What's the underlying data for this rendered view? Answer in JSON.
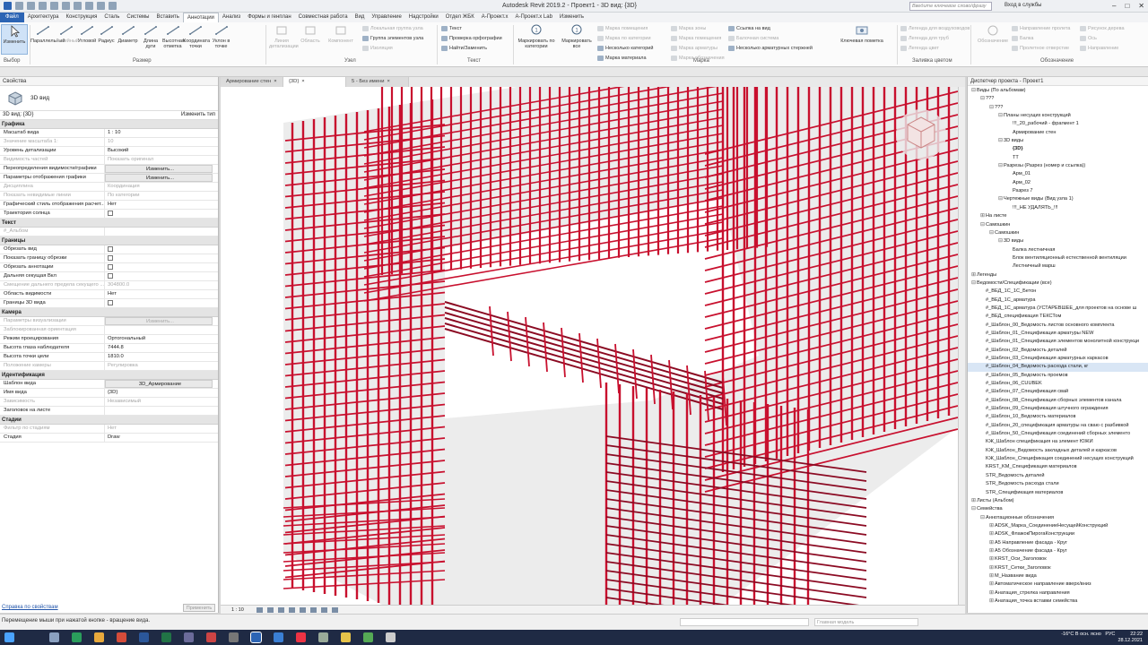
{
  "app": {
    "title": "Autodesk Revit 2019.2 - Проект1 - 3D вид: {3D}",
    "search_placeholder": "Введите ключевое слово/фразу",
    "login": "Вход в службы"
  },
  "tabs": [
    "Файл",
    "Архитектура",
    "Конструкция",
    "Сталь",
    "Системы",
    "Вставить",
    "Аннотации",
    "Анализ",
    "Формы и генплан",
    "Совместная работа",
    "Вид",
    "Управление",
    "Надстройки",
    "Отдел ЖБК",
    "А-Проект.х",
    "А-Проект.х Lab",
    "Изменить"
  ],
  "ribbon": {
    "modify": "Изменить",
    "select": "Выбор",
    "dims": [
      "Параллельный",
      "Линейный",
      "Угловой",
      "Радиус",
      "Диаметр",
      "Длина дуги",
      "Высотная отметка",
      "Координата точки",
      "Уклон в точке"
    ],
    "dim_panel": "Размер",
    "detail": [
      "Линия детализации",
      "Область",
      "Компонент"
    ],
    "detail_small": [
      "Локальная группа узла",
      "Группа элементов узла",
      "Изоляция"
    ],
    "detail_panel": "Узел",
    "text_small": [
      "Текст",
      "Проверка орфографии",
      "Найти/Заменить"
    ],
    "text_panel": "Текст",
    "tag_big": [
      "Маркировать по категории",
      "Маркировать все"
    ],
    "tag_small": [
      "Марка помещения",
      "Марка по категории",
      "Несколько категорий",
      "Марка материала",
      "Марка зоны",
      "Марка помещения",
      "Марка арматуры",
      "Марка обозначения",
      "Ссылка на вид",
      "Балочная система",
      "Несколько арматурных стержней"
    ],
    "tag_panel": "Марка",
    "fill_big": "Ключевая пометка",
    "fill_small": [
      "Легенда для воздуховодов",
      "Легенда для труб",
      "Легенда цвет"
    ],
    "fill_panel": "Заливка цветом",
    "sym_big": "Обозначение",
    "sym_small": [
      "Направление пролета",
      "Балка",
      "Пролетное отверстие",
      "Рисунок дерева",
      "Ось",
      "Направление"
    ],
    "sym_panel": "Обозначение"
  },
  "properties": {
    "header": "Свойства",
    "type_name": "3D вид",
    "selector": "3D вид: {3D}",
    "edit_type": "Изменить тип",
    "rows": [
      {
        "cat": "Графика"
      },
      {
        "k": "Масштаб вида",
        "v": "1 : 10"
      },
      {
        "k": "Значение масштаба    1:",
        "v": "10",
        "dis": true
      },
      {
        "k": "Уровень детализации",
        "v": "Высокий"
      },
      {
        "k": "Видимость частей",
        "v": "Показать оригинал",
        "dis": true
      },
      {
        "k": "Переопределения видимости/графики",
        "v": "Изменить...",
        "btn": true
      },
      {
        "k": "Параметры отображения графики",
        "v": "Изменить...",
        "btn": true
      },
      {
        "k": "Дисциплина",
        "v": "Координация",
        "dis": true
      },
      {
        "k": "Показать невидимые линии",
        "v": "По категории",
        "dis": true
      },
      {
        "k": "Графический стиль отображения расчет...",
        "v": "Нет"
      },
      {
        "k": "Траектория солнца",
        "cb": true
      },
      {
        "cat": "Текст"
      },
      {
        "k": "#_Альбом",
        "v": "",
        "dis": true
      },
      {
        "cat": "Границы"
      },
      {
        "k": "Обрезать вид",
        "cb": true
      },
      {
        "k": "Показать границу обрезки",
        "cb": true
      },
      {
        "k": "Обрезать аннотации",
        "cb": true
      },
      {
        "k": "Дальняя секущая Вкл",
        "cb": true
      },
      {
        "k": "Смещение дальнего предела секущего ...",
        "v": "304800.0",
        "dis": true
      },
      {
        "k": "Область видимости",
        "v": "Нет"
      },
      {
        "k": "Границы 3D вида",
        "cb": true
      },
      {
        "cat": "Камера"
      },
      {
        "k": "Параметры визуализации",
        "v": "Изменить...",
        "btn": true,
        "dis": true
      },
      {
        "k": "Заблокированная ориентация",
        "v": "",
        "dis": true
      },
      {
        "k": "Режим проецирования",
        "v": "Ортогональный"
      },
      {
        "k": "Высота глаза наблюдателя",
        "v": "7444.8"
      },
      {
        "k": "Высота точки цели",
        "v": "1810.0"
      },
      {
        "k": "Положение камеры",
        "v": "Регулировка",
        "dis": true
      },
      {
        "cat": "Идентификация"
      },
      {
        "k": "Шаблон вида",
        "v": "3D_Армирование",
        "btn": true
      },
      {
        "k": "Имя вида",
        "v": "{3D}"
      },
      {
        "k": "Зависимость",
        "v": "Независимый",
        "dis": true
      },
      {
        "k": "Заголовок на листе",
        "v": ""
      },
      {
        "cat": "Стадии"
      },
      {
        "k": "Фильтр по стадиям",
        "v": "Нет",
        "dis": true
      },
      {
        "k": "Стадия",
        "v": "Draw"
      }
    ],
    "help_link": "Справка по свойствам",
    "apply": "Применить"
  },
  "view_tabs": [
    "Армирование стен",
    "{3D}",
    "5 - Без имени"
  ],
  "view_scale": "1 : 10",
  "project_browser": {
    "header": "Диспетчер проекта - Проект1",
    "nodes": [
      {
        "t": "Виды (По альбомам)",
        "l": 0,
        "g": "−"
      },
      {
        "t": "???",
        "l": 1,
        "g": "−"
      },
      {
        "t": "???",
        "l": 2,
        "g": "−"
      },
      {
        "t": "Планы несущих конструкций",
        "l": 3,
        "g": "−"
      },
      {
        "t": "!!!_20_рабочий - фрагмент 1",
        "l": 4
      },
      {
        "t": "Армирование стен",
        "l": 4
      },
      {
        "t": "3D виды",
        "l": 3,
        "g": "−"
      },
      {
        "t": "{3D}",
        "l": 4,
        "b": true
      },
      {
        "t": "TT",
        "l": 4
      },
      {
        "t": "Разрезы (Разрез (номер и ссылка))",
        "l": 3,
        "g": "−"
      },
      {
        "t": "Арм_01",
        "l": 4
      },
      {
        "t": "Арм_02",
        "l": 4
      },
      {
        "t": "Разрез 7",
        "l": 4
      },
      {
        "t": "Чертежные виды (Вид узла 1)",
        "l": 3,
        "g": "−"
      },
      {
        "t": "!!!_НЕ УДАЛЯТЬ_!!!",
        "l": 4
      },
      {
        "t": "На листе",
        "l": 1,
        "g": "+"
      },
      {
        "t": "Самошкин",
        "l": 1,
        "g": "−"
      },
      {
        "t": "Самошкин",
        "l": 2,
        "g": "−"
      },
      {
        "t": "3D виды",
        "l": 3,
        "g": "−"
      },
      {
        "t": "Балка лестничная",
        "l": 4
      },
      {
        "t": "Блок вентиляционный естественной вентиляции",
        "l": 4
      },
      {
        "t": "Лестничный марш",
        "l": 4
      },
      {
        "t": "Легенды",
        "l": 0,
        "g": "+"
      },
      {
        "t": "Ведомости/Спецификации (все)",
        "l": 0,
        "g": "−"
      },
      {
        "t": "#_ВЕД_1С_1С_Бетон",
        "l": 1
      },
      {
        "t": "#_ВЕД_1С_арматура",
        "l": 1
      },
      {
        "t": "#_ВЕД_1С_арматура (УСТАРЕВШЕЕ_для проектов на основе ш",
        "l": 1
      },
      {
        "t": "#_ВЕД_спецификация ТЕКСТом",
        "l": 1
      },
      {
        "t": "#_Шаблон_00_Ведомость листов основного комплекта",
        "l": 1
      },
      {
        "t": "#_Шаблон_01_Спецификация арматуры NEW",
        "l": 1
      },
      {
        "t": "#_Шаблон_01_Спецификация элементов монолитной конструкци",
        "l": 1
      },
      {
        "t": "#_Шаблон_02_Ведомость деталей",
        "l": 1
      },
      {
        "t": "#_Шаблон_03_Спецификация арматурных каркасов",
        "l": 1
      },
      {
        "t": "#_Шаблон_04_Ведомость расхода стали, кг",
        "l": 1,
        "sel": true
      },
      {
        "t": "#_Шаблон_05_Ведомость проемов",
        "l": 1
      },
      {
        "t": "#_Шаблон_06_CUUBEK",
        "l": 1
      },
      {
        "t": "#_Шаблон_07_Спецификация свай",
        "l": 1
      },
      {
        "t": "#_Шаблон_08_Спецификация сборных элементов канала",
        "l": 1
      },
      {
        "t": "#_Шаблон_09_Спецификация штучного ограждения",
        "l": 1
      },
      {
        "t": "#_Шаблон_10_Ведомость материалов",
        "l": 1
      },
      {
        "t": "#_Шаблон_20_спецификация арматуры на сваю с разбивкой",
        "l": 1
      },
      {
        "t": "#_Шаблон_50_Спецификация соединений сборных элементо",
        "l": 1
      },
      {
        "t": "KЖ_Шаблон спецификация на элемент ЮЖИ",
        "l": 1
      },
      {
        "t": "KЖ_Шаблон_Ведомость закладных деталей и каркасов",
        "l": 1
      },
      {
        "t": "KЖ_Шаблон_Спецификация соединений несущих конструкций",
        "l": 1
      },
      {
        "t": "KRST_KM_Спецификация материалов",
        "l": 1
      },
      {
        "t": "STR_Ведомость деталей",
        "l": 1
      },
      {
        "t": "STR_Ведомость расхода стали",
        "l": 1
      },
      {
        "t": "STR_Спецификация материалов",
        "l": 1
      },
      {
        "t": "Листы (Альбом)",
        "l": 0,
        "g": "+"
      },
      {
        "t": "Семейства",
        "l": 0,
        "g": "−"
      },
      {
        "t": "Аннотационные обозначения",
        "l": 1,
        "g": "−"
      },
      {
        "t": "ADSK_Марка_СоединениеНесущейКонструкций",
        "l": 2,
        "g": "+"
      },
      {
        "t": "ADSK_ФлажокПирогаКонструкции",
        "l": 2,
        "g": "+"
      },
      {
        "t": "A5 Направление фасада - Круг",
        "l": 2,
        "g": "+"
      },
      {
        "t": "A5 Обозначение фасада - Круг",
        "l": 2,
        "g": "+"
      },
      {
        "t": "KRST_Оси_Заголовок",
        "l": 2,
        "g": "+"
      },
      {
        "t": "KRST_Сетки_Заголовок",
        "l": 2,
        "g": "+"
      },
      {
        "t": "M_Название вида",
        "l": 2,
        "g": "+"
      },
      {
        "t": "Автоматическое направление вверх/вниз",
        "l": 2,
        "g": "+"
      },
      {
        "t": "Анатация_стрелка направления",
        "l": 2,
        "g": "+"
      },
      {
        "t": "Анатация_точка вставки семейства",
        "l": 2,
        "g": "+"
      }
    ]
  },
  "status": {
    "text": "Перемещение мыши при нажатой кнопке - вращение вида.",
    "model": "Главная модель"
  },
  "tray": {
    "weather": "-16°C В осн. ясно",
    "lang": "РУС",
    "time": "22:22",
    "date": "28.12.2021"
  },
  "colors": {
    "rebar": "#c8102e",
    "rebar_dark": "#8b0a22",
    "accent": "#2c64b4"
  }
}
